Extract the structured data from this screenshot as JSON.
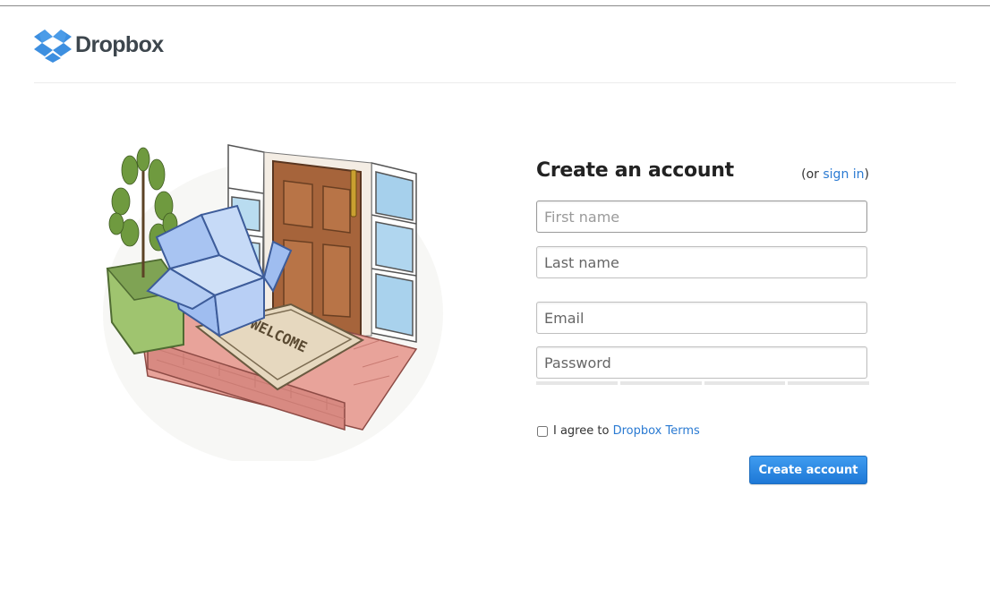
{
  "header": {
    "logo_text": "Dropbox"
  },
  "form": {
    "title": "Create an account",
    "alt_prefix": "(or ",
    "alt_link": "sign in",
    "alt_suffix": ")",
    "first_name_placeholder": "First name",
    "last_name_placeholder": "Last name",
    "email_placeholder": "Email",
    "password_placeholder": "Password",
    "agree_prefix": "I agree to ",
    "agree_link": "Dropbox Terms",
    "submit_label": "Create account"
  },
  "illustration": {
    "doormat_text": "WELCOME"
  },
  "colors": {
    "brand_blue": "#2a7ad2",
    "logo_blue": "#3d8fe0"
  }
}
